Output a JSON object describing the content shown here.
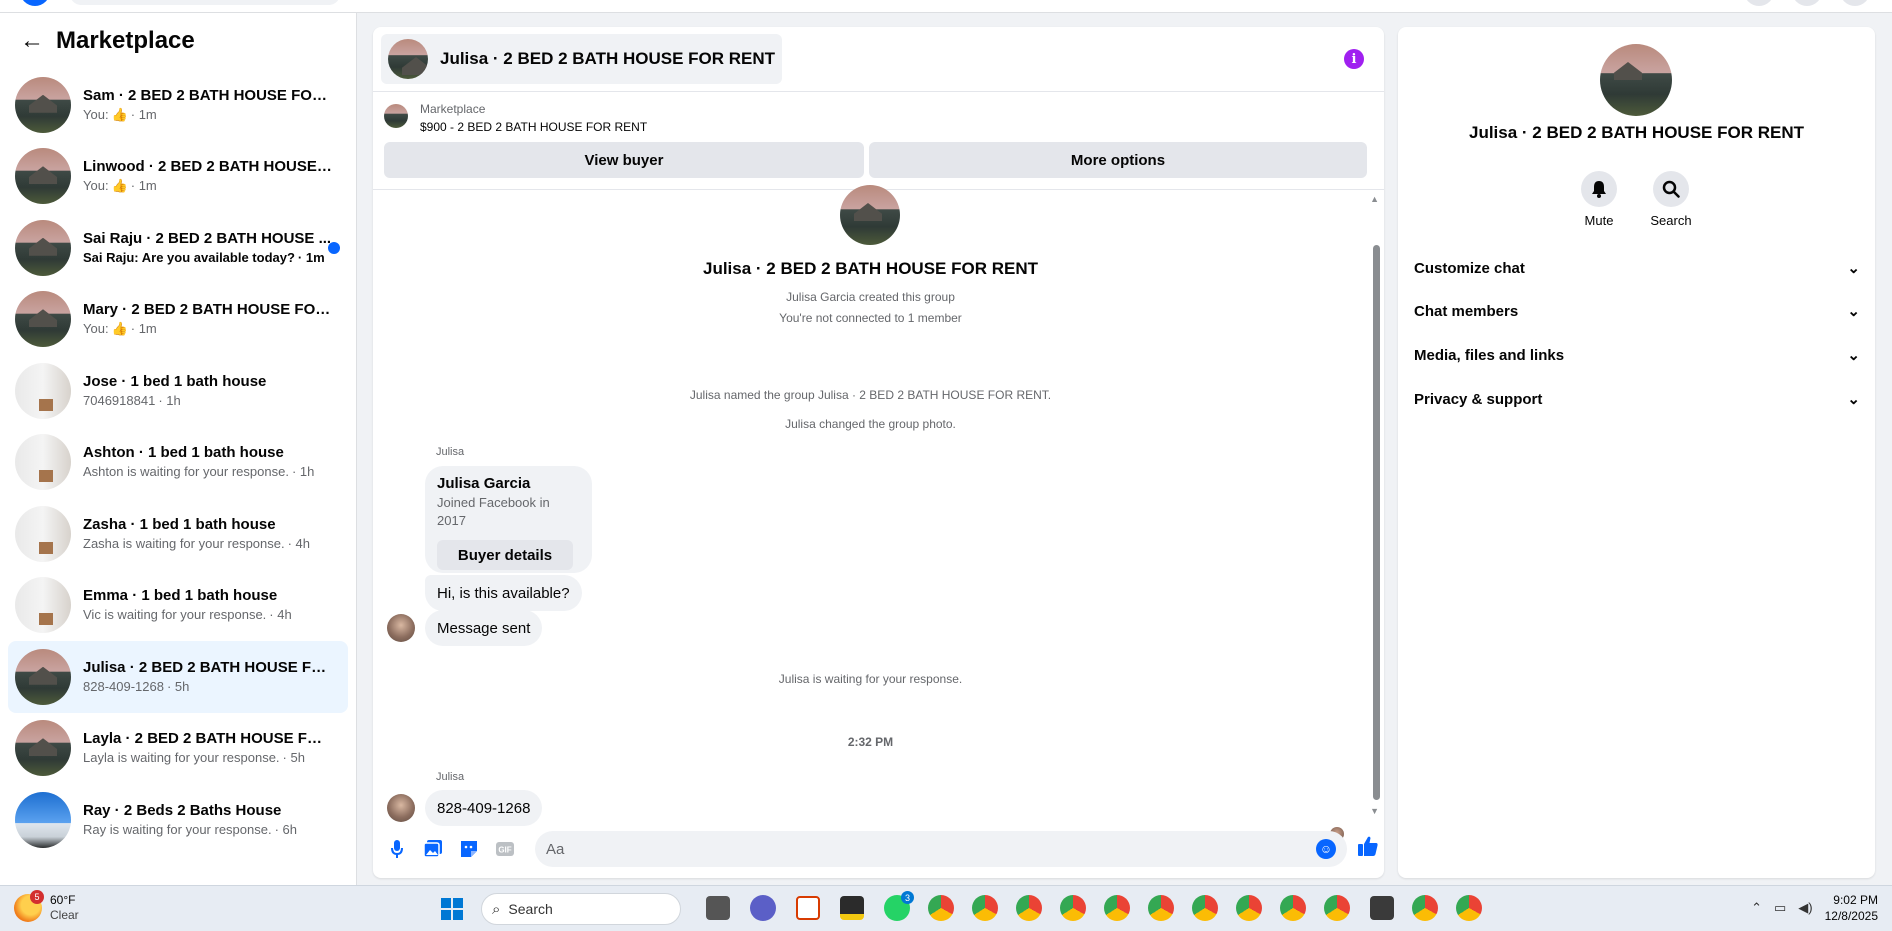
{
  "sidebar": {
    "title": "Marketplace",
    "conversations": [
      {
        "name": "Sam · 2 BED 2 BATH HOUSE FOR R...",
        "sub_prefix": "You: ",
        "sub_suffix": " · 1m",
        "has_like": true,
        "thumb": "house"
      },
      {
        "name": "Linwood · 2 BED 2 BATH HOUSE F...",
        "sub_prefix": "You: ",
        "sub_suffix": " · 1m",
        "has_like": true,
        "thumb": "house"
      },
      {
        "name": "Sai Raju · 2 BED 2 BATH HOUSE ...",
        "sub_prefix": "Sai Raju: Are you available today?",
        "sub_suffix": " · 1m",
        "unread": true,
        "thumb": "house"
      },
      {
        "name": "Mary · 2 BED 2 BATH HOUSE FOR ...",
        "sub_prefix": "You: ",
        "sub_suffix": " · 1m",
        "has_like": true,
        "thumb": "house"
      },
      {
        "name": "Jose · 1 bed 1 bath house",
        "sub_prefix": "7046918841",
        "sub_suffix": " · 1h",
        "thumb": "room"
      },
      {
        "name": "Ashton · 1 bed 1 bath house",
        "sub_prefix": "Ashton is waiting for your response.",
        "sub_suffix": " · 1h",
        "thumb": "room"
      },
      {
        "name": "Zasha · 1 bed 1 bath house",
        "sub_prefix": "Zasha is waiting for your response.",
        "sub_suffix": " · 4h",
        "thumb": "room"
      },
      {
        "name": "Emma · 1 bed 1 bath house",
        "sub_prefix": "Vic is waiting for your response.",
        "sub_suffix": " · 4h",
        "thumb": "room"
      },
      {
        "name": "Julisa · 2 BED 2 BATH HOUSE FOR ...",
        "sub_prefix": "828-409-1268",
        "sub_suffix": " · 5h",
        "active": true,
        "thumb": "house"
      },
      {
        "name": "Layla · 2 BED 2 BATH HOUSE FOR ...",
        "sub_prefix": "Layla is waiting for your response.",
        "sub_suffix": " · 5h",
        "thumb": "house"
      },
      {
        "name": "Ray · 2 Beds 2 Baths House",
        "sub_prefix": "Ray is waiting for your response.",
        "sub_suffix": " · 6h",
        "thumb": "sky"
      }
    ]
  },
  "chat": {
    "title": "Julisa · 2 BED 2 BATH HOUSE FOR RENT",
    "listing": {
      "label": "Marketplace",
      "price_title": "$900 - 2 BED 2 BATH HOUSE FOR RENT",
      "view_buyer": "View buyer",
      "more_options": "More options"
    },
    "intro": {
      "title": "Julisa · 2 BED 2 BATH HOUSE FOR RENT",
      "created": "Julisa Garcia created this group",
      "not_connected": "You're not connected to 1 member"
    },
    "events": {
      "named": "Julisa named the group Julisa · 2 BED 2 BATH HOUSE FOR RENT.",
      "photo": "Julisa changed the group photo."
    },
    "sender_1": "Julisa",
    "card": {
      "name": "Julisa Garcia",
      "joined": "Joined Facebook in 2017",
      "button": "Buyer details"
    },
    "msg_1": "Hi, is this available?",
    "msg_2": "Message sent",
    "waiting": "Julisa is waiting for your response.",
    "timestamp": "2:32 PM",
    "sender_2": "Julisa",
    "msg_3": "828-409-1268",
    "composer_placeholder": "Aa"
  },
  "panel": {
    "title": "Julisa · 2 BED 2 BATH HOUSE FOR RENT",
    "mute": "Mute",
    "search": "Search",
    "sections": [
      "Customize chat",
      "Chat members",
      "Media, files and links",
      "Privacy & support"
    ]
  },
  "taskbar": {
    "weather_badge": "5",
    "temp": "60°F",
    "condition": "Clear",
    "search": "Search",
    "whatsapp_badge": "3",
    "time": "9:02 PM",
    "date": "12/8/2025"
  },
  "colors": {
    "accent": "#0866ff",
    "info": "#a020f0",
    "active_row": "#ebf5ff"
  }
}
